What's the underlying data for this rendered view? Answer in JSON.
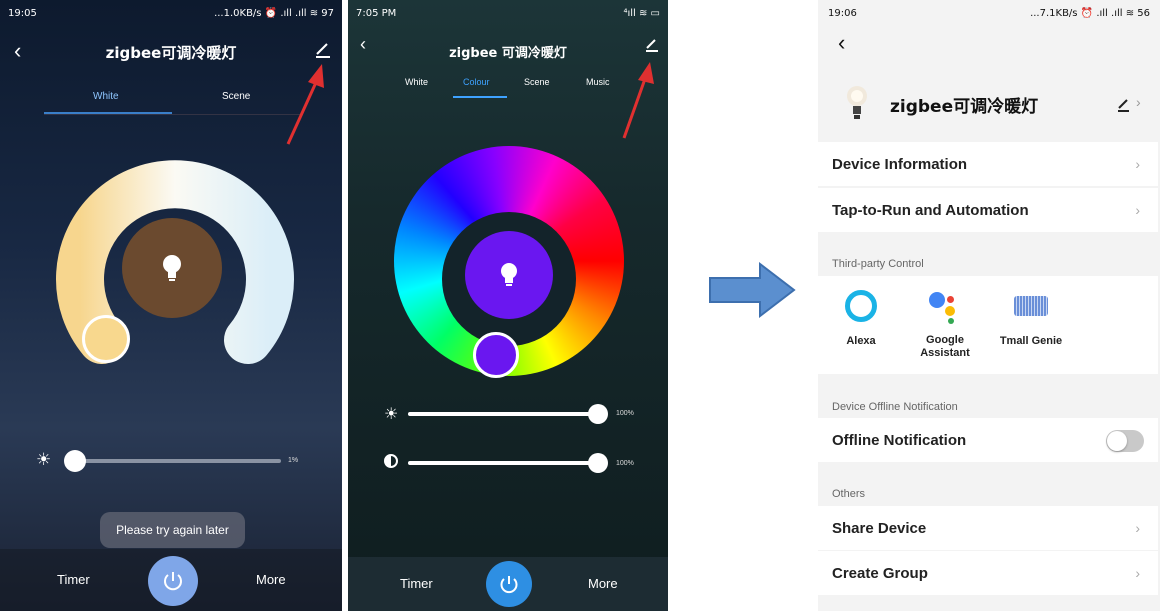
{
  "phone1": {
    "status_time": "19:05",
    "status_right": "...1.0KB/s ⏰ .ıll .ıll ≋ 97",
    "title": "zigbee可调冷暖灯",
    "tabs": [
      "White",
      "Scene"
    ],
    "active_tab": "White",
    "brightness_percent": "1%",
    "brightness_value": 0.01,
    "toast": "Please try again later",
    "bottom": {
      "timer": "Timer",
      "more": "More"
    }
  },
  "phone2": {
    "status_time": "7:05 PM",
    "status_right": "⁴ıll ≋ ▭",
    "title": "zigbee 可调冷暖灯",
    "tabs": [
      "White",
      "Colour",
      "Scene",
      "Music"
    ],
    "active_tab": "Colour",
    "brightness_percent": "100%",
    "contrast_percent": "100%",
    "brightness_value": 1.0,
    "contrast_value": 1.0,
    "bottom": {
      "timer": "Timer",
      "more": "More"
    }
  },
  "phone3": {
    "status_time": "19:06",
    "status_right": "...7.1KB/s ⏰ .ıll .ıll ≋ 56",
    "device_name": "zigbee可调冷暖灯",
    "rows": {
      "device_info": "Device Information",
      "tap_to_run": "Tap-to-Run and Automation",
      "offline_notification": "Offline Notification",
      "share_device": "Share Device",
      "create_group": "Create Group"
    },
    "sections": {
      "third_party": "Third-party Control",
      "offline": "Device Offline Notification",
      "others": "Others"
    },
    "third_party_items": [
      {
        "label": "Alexa",
        "icon": "alexa-icon"
      },
      {
        "label": "Google Assistant",
        "icon": "google-assistant-icon"
      },
      {
        "label": "Tmall Genie",
        "icon": "tmall-genie-icon"
      }
    ],
    "offline_toggle_on": false
  },
  "colors": {
    "accent_blue": "#2e8fe3",
    "arrow_red": "#e03030",
    "flow_arrow": "#5b8fcf"
  }
}
